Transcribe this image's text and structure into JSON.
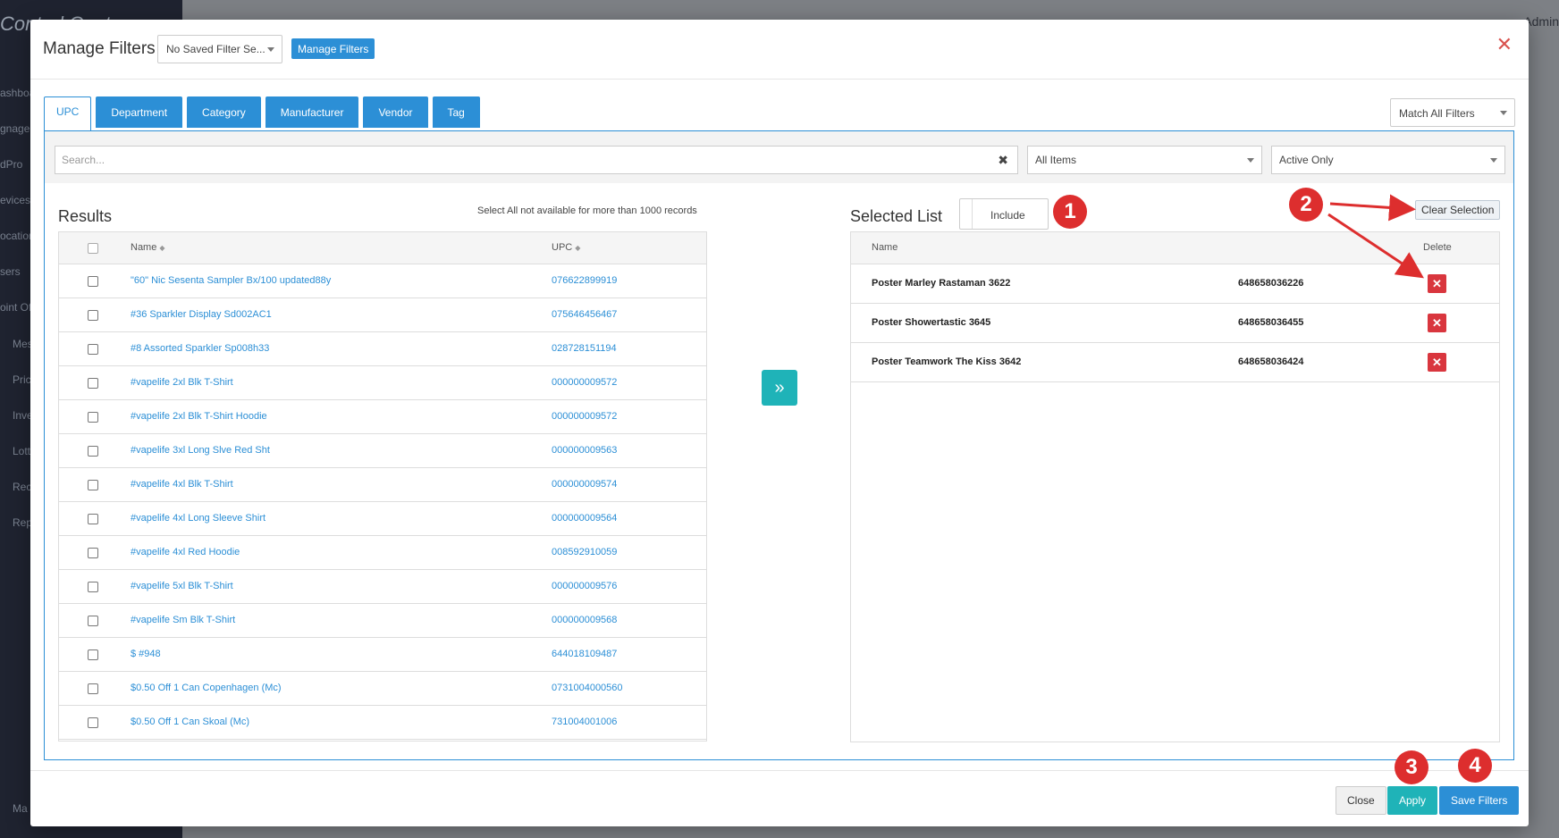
{
  "background": {
    "brand": "Control Center",
    "nav_items": [
      "ashboard",
      "gnage",
      "dPro",
      "evices",
      "ocation",
      "sers",
      "oint Of",
      "Mes",
      "Pric",
      "Inve",
      "Lott",
      "Rec",
      "Rep",
      "Ma"
    ],
    "user_label": "Admin"
  },
  "modal": {
    "title": "Manage Filters",
    "saved_filter": "No Saved Filter Se...",
    "manage_filters_label": "Manage Filters",
    "close_glyph": "✕"
  },
  "tabs": [
    "UPC",
    "Department",
    "Category",
    "Manufacturer",
    "Vendor",
    "Tag"
  ],
  "match_mode": "Match All Filters",
  "filters": {
    "search_placeholder": "Search...",
    "items_scope": "All Items",
    "status": "Active Only"
  },
  "results": {
    "title": "Results",
    "note": "Select All not available for more than 1000 records",
    "columns": {
      "name": "Name",
      "upc": "UPC"
    },
    "rows": [
      {
        "name": "\"60\" Nic Sesenta Sampler Bx/100 updated88y",
        "upc": "076622899919"
      },
      {
        "name": "#36 Sparkler Display Sd002AC1",
        "upc": "075646456467"
      },
      {
        "name": "#8 Assorted Sparkler Sp008h33",
        "upc": "028728151194"
      },
      {
        "name": "#vapelife 2xl Blk T-Shirt",
        "upc": "000000009572"
      },
      {
        "name": "#vapelife 2xl Blk T-Shirt Hoodie",
        "upc": "000000009572"
      },
      {
        "name": "#vapelife 3xl Long Slve Red Sht",
        "upc": "000000009563"
      },
      {
        "name": "#vapelife 4xl Blk T-Shirt",
        "upc": "000000009574"
      },
      {
        "name": "#vapelife 4xl Long Sleeve Shirt",
        "upc": "000000009564"
      },
      {
        "name": "#vapelife 4xl Red Hoodie",
        "upc": "008592910059"
      },
      {
        "name": "#vapelife 5xl Blk T-Shirt",
        "upc": "000000009576"
      },
      {
        "name": "#vapelife Sm Blk T-Shirt",
        "upc": "000000009568"
      },
      {
        "name": "$ #948",
        "upc": "644018109487"
      },
      {
        "name": "$0.50 Off 1 Can Copenhagen (Mc)",
        "upc": "0731004000560"
      },
      {
        "name": "$0.50 Off 1 Can Skoal (Mc)",
        "upc": "731004001006"
      }
    ]
  },
  "move_glyph": "»",
  "selected": {
    "title": "Selected List",
    "mode_label": "Include",
    "clear_label": "Clear Selection",
    "columns": {
      "name": "Name",
      "delete": "Delete"
    },
    "rows": [
      {
        "name": "Poster Marley Rastaman 3622",
        "upc": "648658036226"
      },
      {
        "name": "Poster Showertastic 3645",
        "upc": "648658036455"
      },
      {
        "name": "Poster Teamwork The Kiss 3642",
        "upc": "648658036424"
      }
    ],
    "delete_glyph": "✕"
  },
  "annotations": [
    "1",
    "2",
    "3",
    "4"
  ],
  "footer": {
    "close_label": "Close",
    "apply_label": "Apply",
    "save_label": "Save Filters"
  },
  "colors": {
    "primary": "#2c8fd6",
    "teal": "#1fb3b8",
    "danger": "#d9363e",
    "annotation": "#dd2e2e"
  }
}
